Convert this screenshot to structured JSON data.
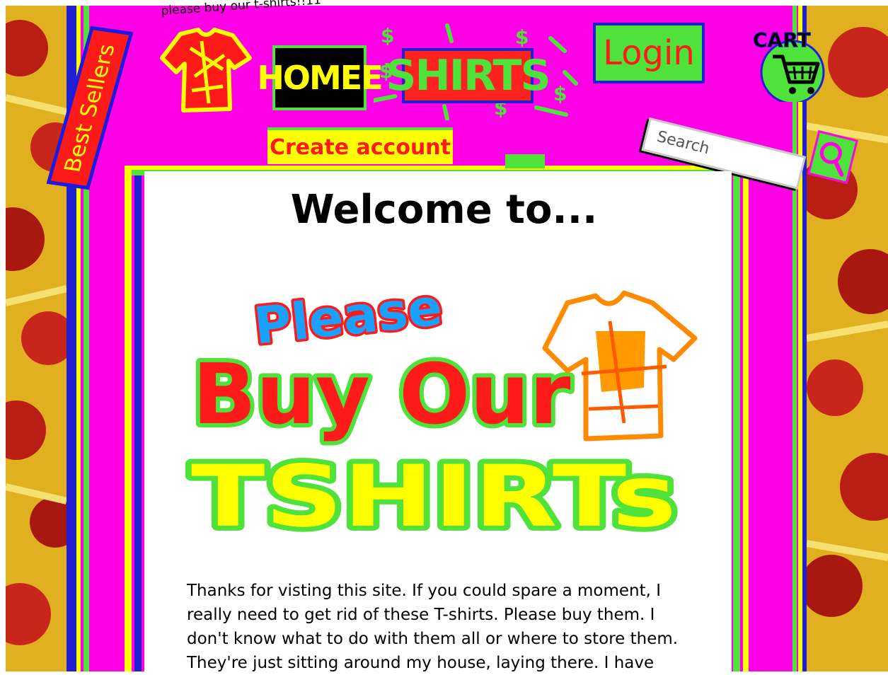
{
  "header": {
    "tagline": "please buy our t-shirts!!11",
    "best_sellers_label": "Best Sellers",
    "home_label": "HOMEE",
    "shirts_label": "SHIRTS",
    "login_label": "Login",
    "cart_label": "CART",
    "create_account_label": "Create account",
    "search_placeholder": "Search"
  },
  "main": {
    "welcome_heading": "Welcome to...",
    "banner": {
      "line1": "Please",
      "line2": "Buy Our",
      "line3": "TSHIRTs"
    },
    "intro_text": "Thanks for visting this site. If you could spare a moment, I really need to get rid of these T-shirts. Please buy them. I don't know what to do with them all or where to store them. They're just sitting around my house, laying there. I have"
  },
  "colors": {
    "magenta": "#ff00e6",
    "green": "#4fe23a",
    "yellow": "#ffff00",
    "red": "#ff1a1a",
    "blue": "#2020d0",
    "pizza_red": "#c8261a"
  },
  "icons": [
    "tshirt-icon",
    "shopping-cart-icon",
    "magnifier-icon",
    "dollar-sparkle-icon"
  ]
}
